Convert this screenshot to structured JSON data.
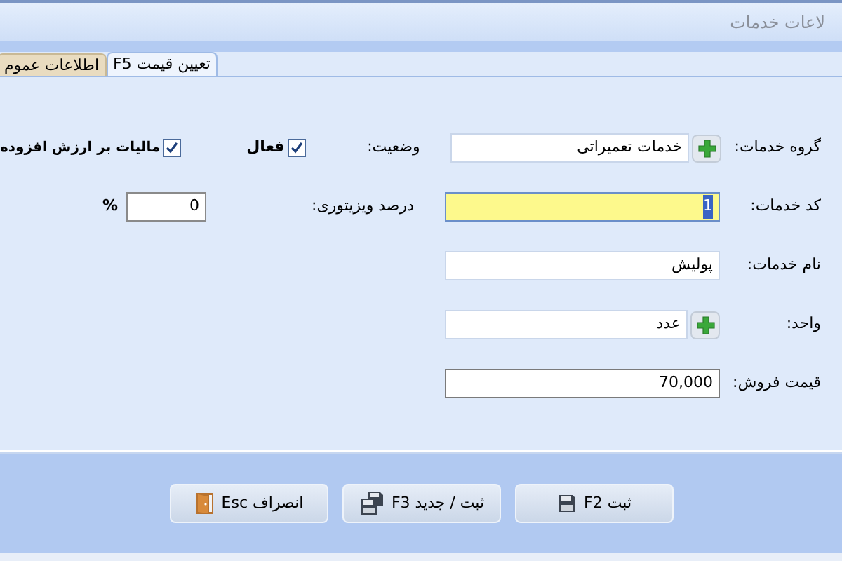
{
  "window": {
    "title": "لاعات خدمات"
  },
  "tabs": [
    {
      "label": "تعیین قیمت F5",
      "selected": true
    },
    {
      "label": "اطلاعات عموم",
      "selected": false
    }
  ],
  "fields": [
    {
      "label": "گروه خدمات:",
      "kind": "lookup",
      "value": "خدمات تعمیراتی",
      "focused": false
    },
    {
      "label": "کد خدمات:",
      "kind": "text",
      "value": "1",
      "focused": true
    },
    {
      "label": "نام خدمات:",
      "kind": "text",
      "value": "پولیش",
      "focused": false
    },
    {
      "label": "واحد:",
      "kind": "lookup",
      "value": "عدد",
      "focused": false
    },
    {
      "label": "قیمت فروش:",
      "kind": "number",
      "value": "70,000",
      "focused": false
    }
  ],
  "status": {
    "label": "وضعیت:",
    "checkbox": {
      "label": "فعال",
      "checked": true
    }
  },
  "vat": {
    "label": "مالیات بر ارزش افزوده",
    "checked": true
  },
  "visitor_percent": {
    "label": "درصد ویزیتوری:",
    "value": "0",
    "unit": "%"
  },
  "buttons": [
    {
      "label": "ثبت F2",
      "kind": "save"
    },
    {
      "label": "ثبت / جدید F3",
      "kind": "save-new"
    },
    {
      "label": "انصراف Esc",
      "kind": "exit"
    }
  ]
}
